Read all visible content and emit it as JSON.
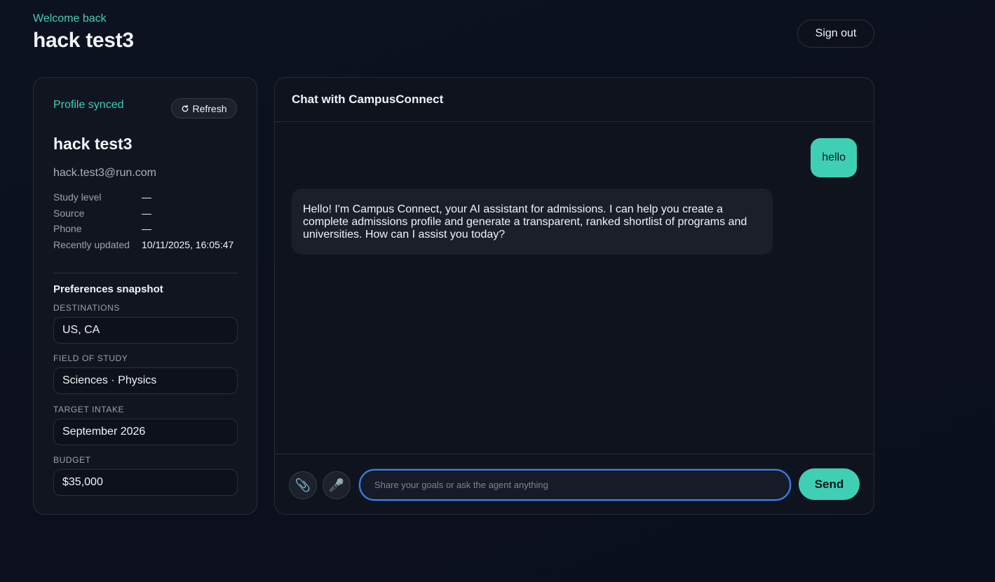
{
  "header": {
    "welcome": "Welcome back",
    "user_name": "hack test3",
    "sign_out_label": "Sign out"
  },
  "profile": {
    "status": "Profile synced",
    "refresh_label": "Refresh",
    "name": "hack test3",
    "email": "hack.test3@run.com",
    "info": [
      {
        "key": "Study level",
        "value": "—"
      },
      {
        "key": "Source",
        "value": "—"
      },
      {
        "key": "Phone",
        "value": "—"
      },
      {
        "key": "Recently updated",
        "value": "10/11/2025, 16:05:47"
      }
    ],
    "preferences_title": "Preferences snapshot",
    "preferences": [
      {
        "label": "DESTINATIONS",
        "value": "US, CA"
      },
      {
        "label": "FIELD OF STUDY",
        "value": "Sciences · Physics"
      },
      {
        "label": "TARGET INTAKE",
        "value": "September 2026"
      },
      {
        "label": "BUDGET",
        "value": "$35,000"
      }
    ]
  },
  "chat": {
    "title": "Chat with CampusConnect",
    "messages": [
      {
        "role": "user",
        "text": "hello"
      },
      {
        "role": "assistant",
        "text": "Hello! I'm Campus Connect, your AI assistant for admissions. I can help you create a complete admissions profile and generate a transparent, ranked shortlist of programs and universities. How can I assist you today?"
      }
    ],
    "input_placeholder": "Share your goals or ask the agent anything",
    "input_value": "",
    "send_label": "Send",
    "attach_icon": "paperclip-icon",
    "mic_icon": "microphone-icon"
  },
  "colors": {
    "accent": "#3ecfb5",
    "background": "#0d1220",
    "panel": "#111520",
    "focus": "#3b82f6"
  }
}
